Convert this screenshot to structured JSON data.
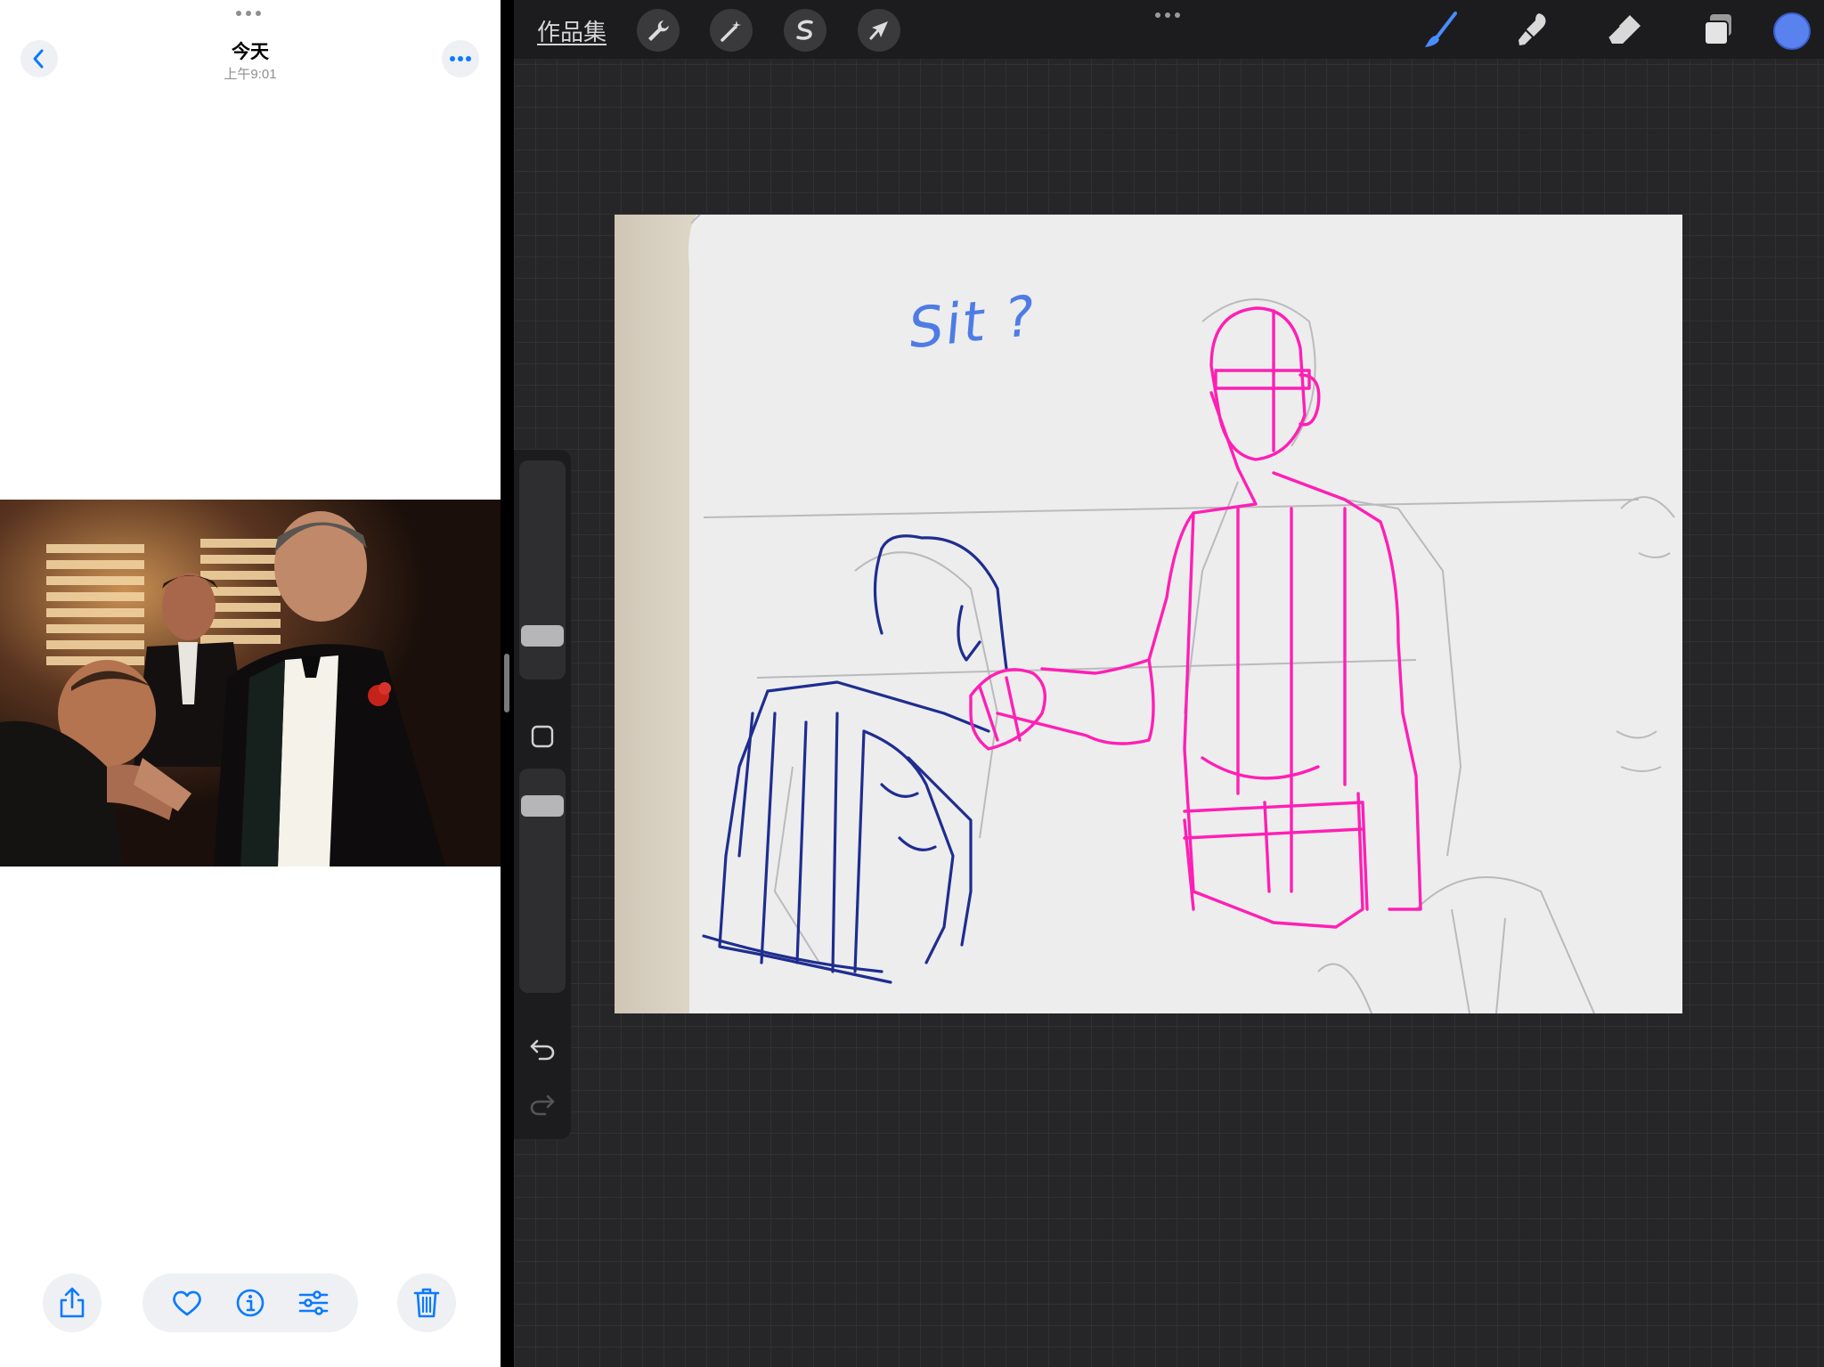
{
  "photos": {
    "title": "今天",
    "time": "上午9:01",
    "photo_subject": "film still: man kissing the hand of a man in a tuxedo with a red rose",
    "toolbar": {
      "share": "share-icon",
      "favorite": "heart-icon",
      "info": "info-icon",
      "adjust": "sliders-icon",
      "delete": "trash-icon"
    }
  },
  "procreate": {
    "gallery_label": "作品集",
    "actions_icon": "wrench-icon",
    "adjustments_icon": "magic-wand-icon",
    "selection_icon": "selection-icon",
    "transform_icon": "arrow-cursor-icon",
    "brush_icon": "brush-icon",
    "smudge_icon": "smudge-icon",
    "eraser_icon": "eraser-icon",
    "layers_icon": "layers-icon",
    "active_color": "#5a82ef",
    "canvas_note": "Sit ?"
  }
}
